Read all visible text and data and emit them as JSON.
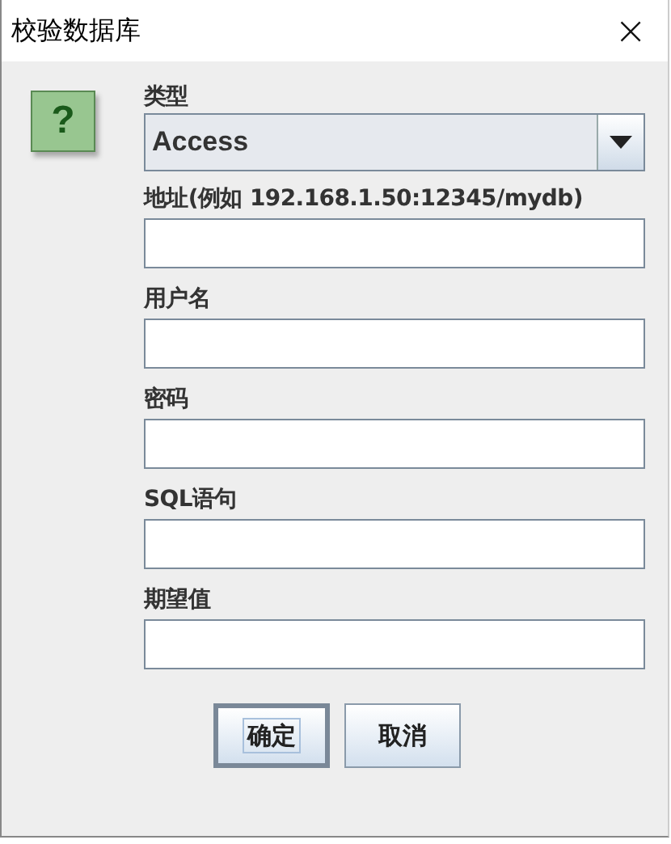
{
  "window": {
    "title": "校验数据库",
    "close": "×"
  },
  "icon": {
    "glyph": "?"
  },
  "fields": [
    {
      "kind": "combo",
      "label": "类型",
      "value": "Access"
    },
    {
      "kind": "text",
      "label": "地址(例如 192.168.1.50:12345/mydb)"
    },
    {
      "kind": "text",
      "label": "用户名"
    },
    {
      "kind": "text",
      "label": "密码"
    },
    {
      "kind": "text",
      "label": "SQL语句"
    },
    {
      "kind": "text",
      "label": "期望值"
    }
  ],
  "buttons": [
    {
      "label": "确定",
      "focused": true
    },
    {
      "label": "取消",
      "focused": false
    }
  ]
}
